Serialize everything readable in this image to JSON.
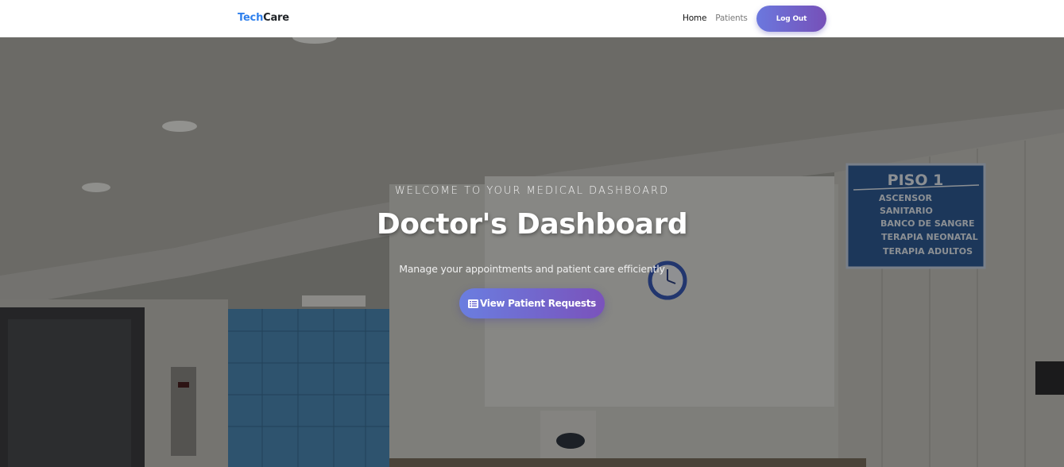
{
  "navbar": {
    "brand": {
      "part1": "Tech",
      "part2": "Care"
    },
    "links": [
      {
        "label": "Home",
        "active": true
      },
      {
        "label": "Patients",
        "active": false
      }
    ],
    "logout_label": "Log Out"
  },
  "hero": {
    "subtitle": "WELCOME TO YOUR MEDICAL DASHBOARD",
    "title": "Doctor's Dashboard",
    "description": "Manage your appointments and patient care efficiently",
    "cta": {
      "label": "View Patient Requests",
      "icon": "list-icon"
    },
    "background": {
      "sign": {
        "title": "PISO 1",
        "items": [
          "ASCENSOR",
          "SANITARIO",
          "BANCO DE SANGRE",
          "TERAPIA NEONATAL",
          "TERAPIA ADULTOS"
        ]
      }
    }
  },
  "colors": {
    "brand_accent": "#2f80ed",
    "button_gradient_start": "#6b78de",
    "button_gradient_end": "#7650b8"
  }
}
